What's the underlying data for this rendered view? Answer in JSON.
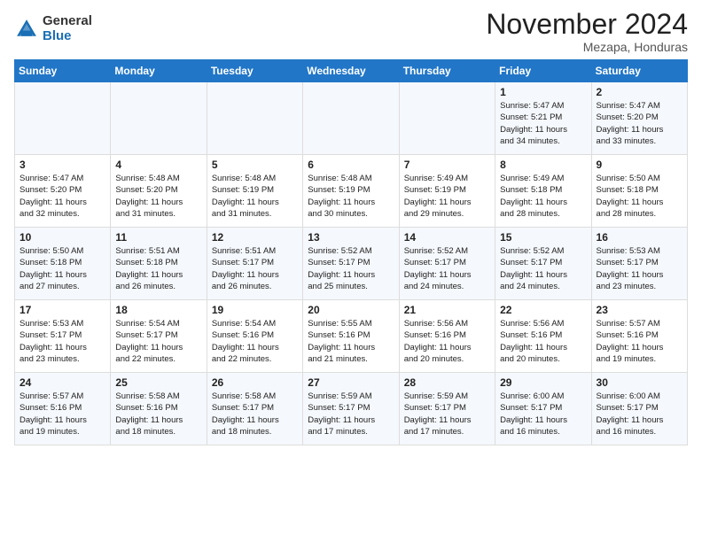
{
  "logo": {
    "general": "General",
    "blue": "Blue"
  },
  "title": "November 2024",
  "subtitle": "Mezapa, Honduras",
  "headers": [
    "Sunday",
    "Monday",
    "Tuesday",
    "Wednesday",
    "Thursday",
    "Friday",
    "Saturday"
  ],
  "weeks": [
    [
      {
        "day": "",
        "info": ""
      },
      {
        "day": "",
        "info": ""
      },
      {
        "day": "",
        "info": ""
      },
      {
        "day": "",
        "info": ""
      },
      {
        "day": "",
        "info": ""
      },
      {
        "day": "1",
        "info": "Sunrise: 5:47 AM\nSunset: 5:21 PM\nDaylight: 11 hours\nand 34 minutes."
      },
      {
        "day": "2",
        "info": "Sunrise: 5:47 AM\nSunset: 5:20 PM\nDaylight: 11 hours\nand 33 minutes."
      }
    ],
    [
      {
        "day": "3",
        "info": "Sunrise: 5:47 AM\nSunset: 5:20 PM\nDaylight: 11 hours\nand 32 minutes."
      },
      {
        "day": "4",
        "info": "Sunrise: 5:48 AM\nSunset: 5:20 PM\nDaylight: 11 hours\nand 31 minutes."
      },
      {
        "day": "5",
        "info": "Sunrise: 5:48 AM\nSunset: 5:19 PM\nDaylight: 11 hours\nand 31 minutes."
      },
      {
        "day": "6",
        "info": "Sunrise: 5:48 AM\nSunset: 5:19 PM\nDaylight: 11 hours\nand 30 minutes."
      },
      {
        "day": "7",
        "info": "Sunrise: 5:49 AM\nSunset: 5:19 PM\nDaylight: 11 hours\nand 29 minutes."
      },
      {
        "day": "8",
        "info": "Sunrise: 5:49 AM\nSunset: 5:18 PM\nDaylight: 11 hours\nand 28 minutes."
      },
      {
        "day": "9",
        "info": "Sunrise: 5:50 AM\nSunset: 5:18 PM\nDaylight: 11 hours\nand 28 minutes."
      }
    ],
    [
      {
        "day": "10",
        "info": "Sunrise: 5:50 AM\nSunset: 5:18 PM\nDaylight: 11 hours\nand 27 minutes."
      },
      {
        "day": "11",
        "info": "Sunrise: 5:51 AM\nSunset: 5:18 PM\nDaylight: 11 hours\nand 26 minutes."
      },
      {
        "day": "12",
        "info": "Sunrise: 5:51 AM\nSunset: 5:17 PM\nDaylight: 11 hours\nand 26 minutes."
      },
      {
        "day": "13",
        "info": "Sunrise: 5:52 AM\nSunset: 5:17 PM\nDaylight: 11 hours\nand 25 minutes."
      },
      {
        "day": "14",
        "info": "Sunrise: 5:52 AM\nSunset: 5:17 PM\nDaylight: 11 hours\nand 24 minutes."
      },
      {
        "day": "15",
        "info": "Sunrise: 5:52 AM\nSunset: 5:17 PM\nDaylight: 11 hours\nand 24 minutes."
      },
      {
        "day": "16",
        "info": "Sunrise: 5:53 AM\nSunset: 5:17 PM\nDaylight: 11 hours\nand 23 minutes."
      }
    ],
    [
      {
        "day": "17",
        "info": "Sunrise: 5:53 AM\nSunset: 5:17 PM\nDaylight: 11 hours\nand 23 minutes."
      },
      {
        "day": "18",
        "info": "Sunrise: 5:54 AM\nSunset: 5:17 PM\nDaylight: 11 hours\nand 22 minutes."
      },
      {
        "day": "19",
        "info": "Sunrise: 5:54 AM\nSunset: 5:16 PM\nDaylight: 11 hours\nand 22 minutes."
      },
      {
        "day": "20",
        "info": "Sunrise: 5:55 AM\nSunset: 5:16 PM\nDaylight: 11 hours\nand 21 minutes."
      },
      {
        "day": "21",
        "info": "Sunrise: 5:56 AM\nSunset: 5:16 PM\nDaylight: 11 hours\nand 20 minutes."
      },
      {
        "day": "22",
        "info": "Sunrise: 5:56 AM\nSunset: 5:16 PM\nDaylight: 11 hours\nand 20 minutes."
      },
      {
        "day": "23",
        "info": "Sunrise: 5:57 AM\nSunset: 5:16 PM\nDaylight: 11 hours\nand 19 minutes."
      }
    ],
    [
      {
        "day": "24",
        "info": "Sunrise: 5:57 AM\nSunset: 5:16 PM\nDaylight: 11 hours\nand 19 minutes."
      },
      {
        "day": "25",
        "info": "Sunrise: 5:58 AM\nSunset: 5:16 PM\nDaylight: 11 hours\nand 18 minutes."
      },
      {
        "day": "26",
        "info": "Sunrise: 5:58 AM\nSunset: 5:17 PM\nDaylight: 11 hours\nand 18 minutes."
      },
      {
        "day": "27",
        "info": "Sunrise: 5:59 AM\nSunset: 5:17 PM\nDaylight: 11 hours\nand 17 minutes."
      },
      {
        "day": "28",
        "info": "Sunrise: 5:59 AM\nSunset: 5:17 PM\nDaylight: 11 hours\nand 17 minutes."
      },
      {
        "day": "29",
        "info": "Sunrise: 6:00 AM\nSunset: 5:17 PM\nDaylight: 11 hours\nand 16 minutes."
      },
      {
        "day": "30",
        "info": "Sunrise: 6:00 AM\nSunset: 5:17 PM\nDaylight: 11 hours\nand 16 minutes."
      }
    ]
  ]
}
